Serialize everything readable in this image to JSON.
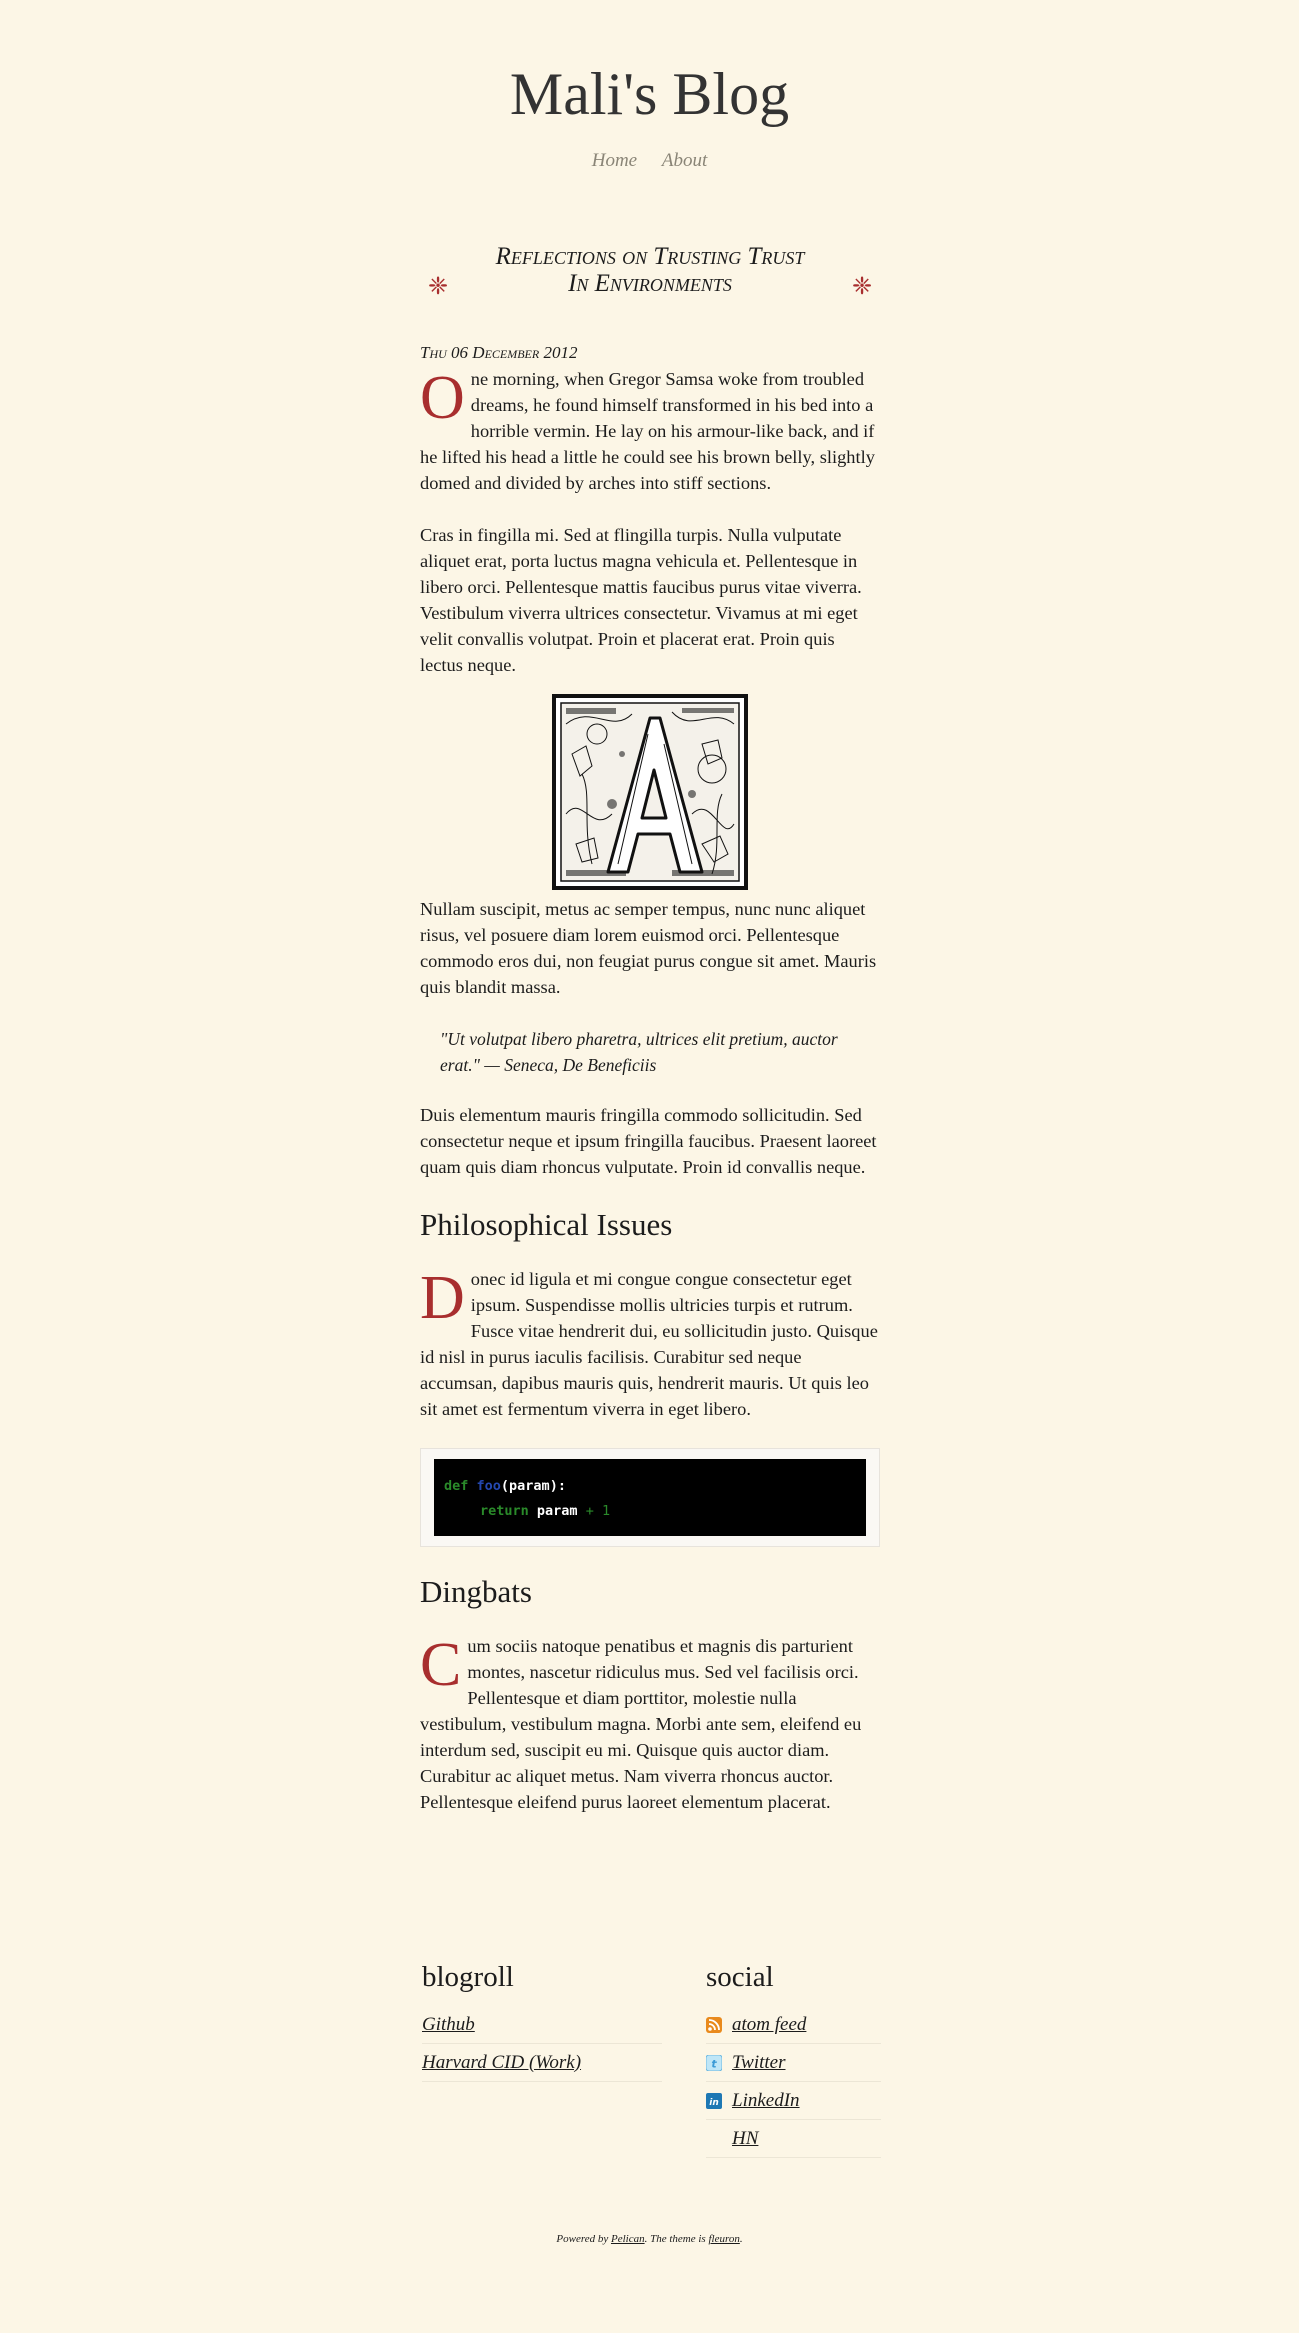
{
  "site": {
    "title": "Mali's Blog"
  },
  "nav": {
    "items": [
      "Home",
      "About"
    ]
  },
  "article": {
    "title_line1": "Reflections on Trusting Trust",
    "title_line2": "In Environments",
    "date": "Thu 06 December 2012",
    "p1_cap": "O",
    "p1_rest": "ne morning, when Gregor Samsa woke from troubled dreams, he found himself transformed in his bed into a horrible vermin. He lay on his armour-like back, and if he lifted his head a little he could see his brown belly, slightly domed and divided by arches into stiff sections.",
    "p2": "Cras in fingilla mi. Sed at flingilla turpis. Nulla vulputate aliquet erat, porta luctus magna vehicula et. Pellentesque in libero orci. Pellentesque mattis faucibus purus vitae viverra. Vestibulum viverra ultrices consectetur. Vivamus at mi eget velit convallis volutpat. Proin et placerat erat. Proin quis lectus neque.",
    "p3": "Nullam suscipit, metus ac semper tempus, nunc nunc aliquet risus, vel posuere diam lorem euismod orci. Pellentesque commodo eros dui, non feugiat purus congue sit amet. Mauris quis blandit massa.",
    "quote": "\"Ut volutpat libero pharetra, ultrices elit pretium, auctor erat.\" — Seneca, De Beneficiis",
    "p4": "Duis elementum mauris fringilla commodo sollicitudin. Sed consectetur neque et ipsum fringilla faucibus. Praesent laoreet quam quis diam rhoncus vulputate. Proin id convallis neque.",
    "h_philosophical": "Philosophical Issues",
    "p5_cap": "D",
    "p5_rest": "onec id ligula et mi congue congue consectetur eget ipsum. Suspendisse mollis ultricies turpis et rutrum. Fusce vitae hendrerit dui, eu sollicitudin justo. Quisque id nisl in purus iaculis facilisis. Curabitur sed neque accumsan, dapibus mauris quis, hendrerit mauris. Ut quis leo sit amet est fermentum viverra in eget libero.",
    "code": {
      "l1_kw": "def",
      "l1_fn": "foo",
      "l1_rest": "(param):",
      "l2_kw": "return",
      "l2_var": "param",
      "l2_op": "+",
      "l2_num": "1"
    },
    "h_dingbats": "Dingbats",
    "p6_cap": "C",
    "p6_rest": "um sociis natoque penatibus et magnis dis parturient montes, nascetur ridiculus mus. Sed vel facilisis orci. Pellentesque et diam porttitor, molestie nulla vestibulum, vestibulum magna. Morbi ante sem, eleifend eu interdum sed, suscipit eu mi. Quisque quis auctor diam. Curabitur ac aliquet metus. Nam viverra rhoncus auctor. Pellentesque eleifend purus laoreet elementum placerat."
  },
  "blogroll": {
    "title": "blogroll",
    "links": [
      "Github",
      "Harvard CID (Work)"
    ]
  },
  "social": {
    "title": "social",
    "links": [
      "atom feed",
      "Twitter",
      "LinkedIn",
      "HN"
    ]
  },
  "footer": {
    "prefix": "Powered by",
    "pelican": "Pelican",
    "middle": ". The theme is",
    "theme": "fleuron",
    "suffix": "."
  },
  "colors": {
    "background": "#fcf6e6",
    "accent": "#a82e2e",
    "nav": "#8a8577"
  }
}
